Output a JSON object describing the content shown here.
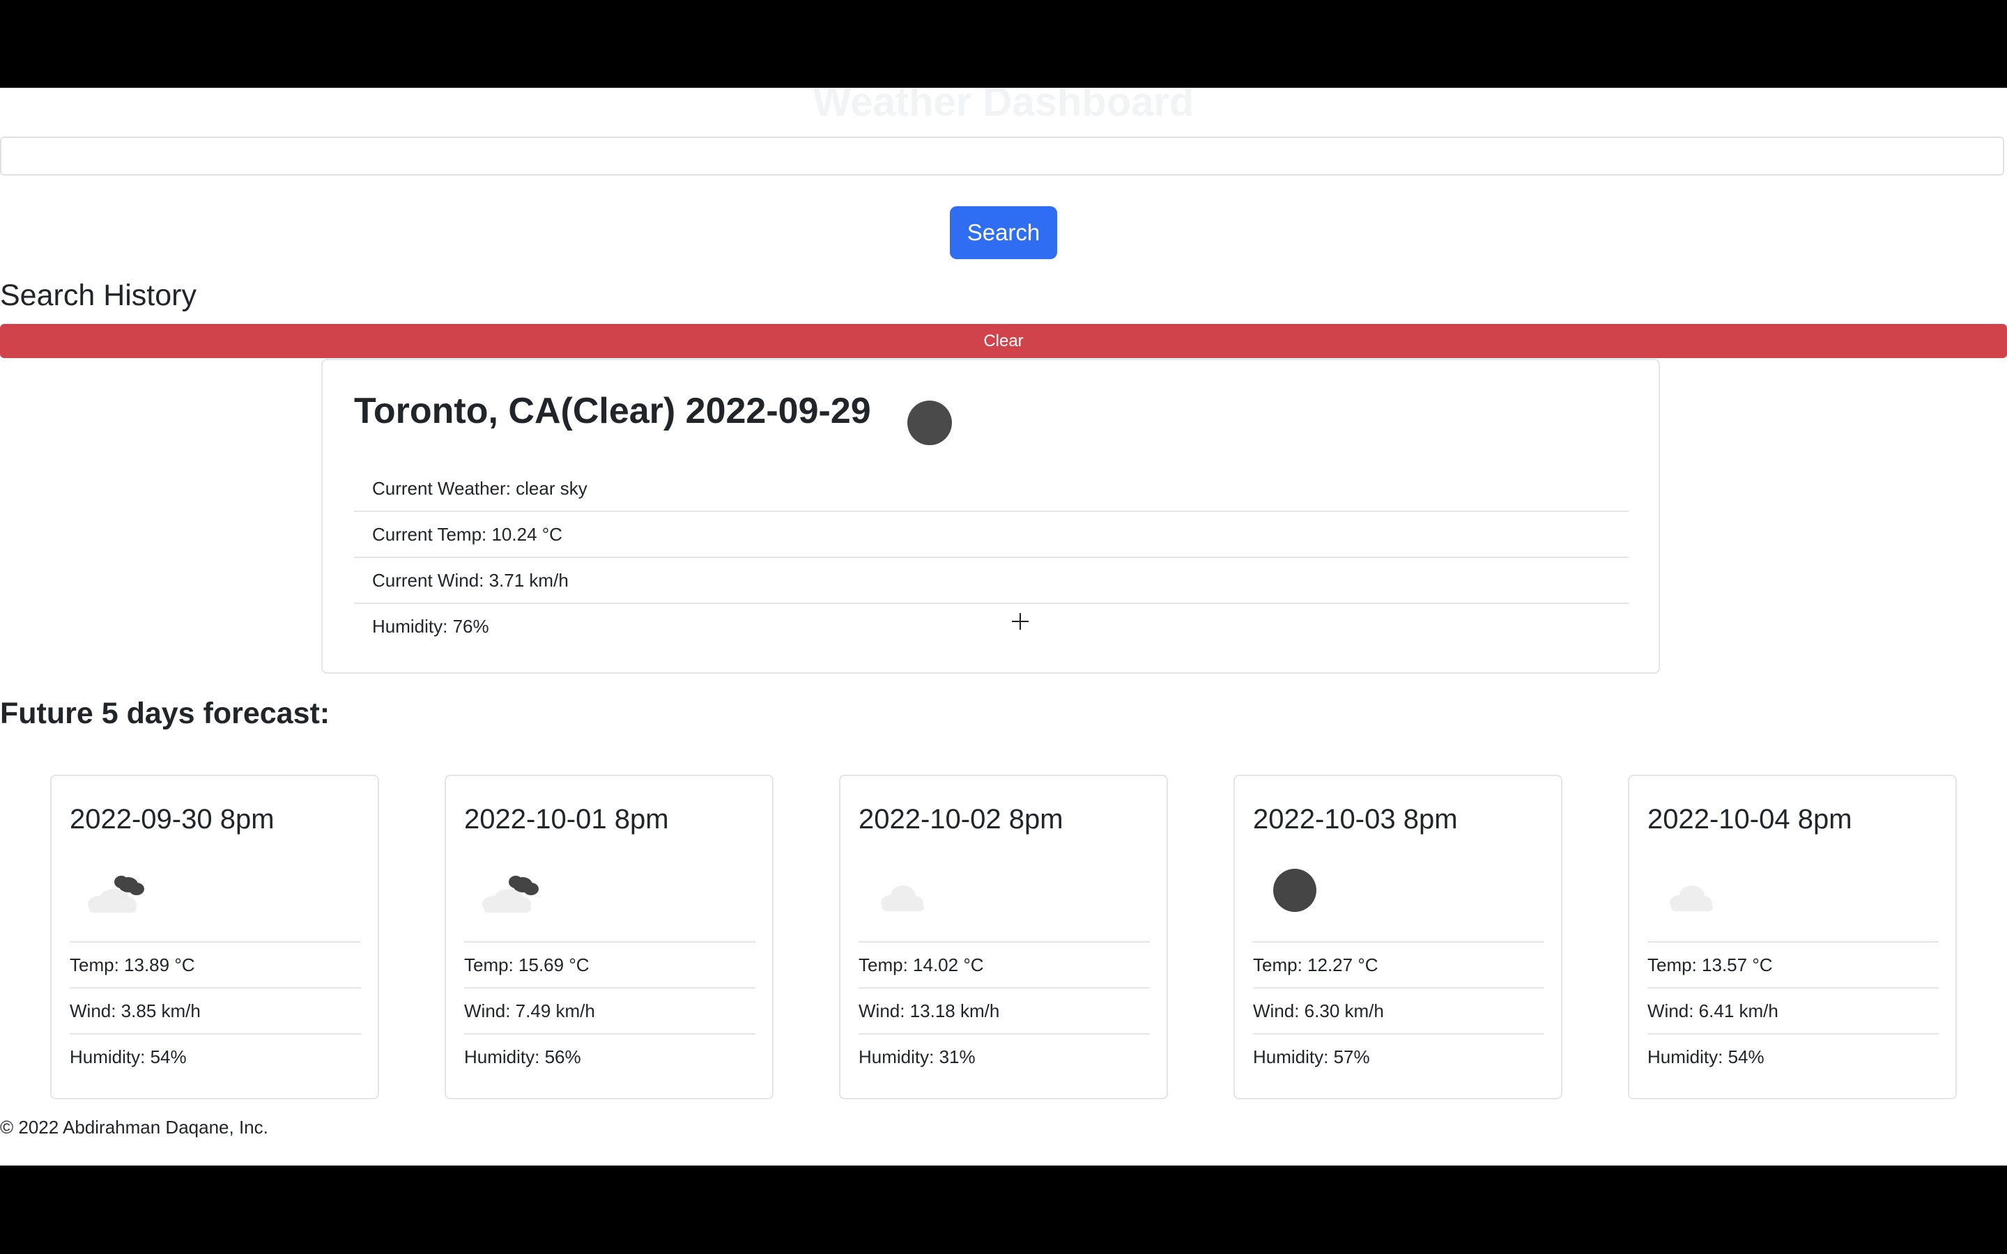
{
  "header": {
    "title": "Weather Dashboard"
  },
  "search": {
    "placeholder": "",
    "value": "",
    "button_label": "Search"
  },
  "history": {
    "heading": "Search History",
    "clear_label": "Clear"
  },
  "current": {
    "title": "Toronto, CA(Clear) 2022-09-29",
    "icon": "clear-sky-icon",
    "details": [
      "Current Weather: clear sky",
      "Current Temp: 10.24 °C",
      "Current Wind: 3.71 km/h",
      "Humidity: 76%"
    ]
  },
  "forecast": {
    "heading": "Future 5 days forecast:",
    "days": [
      {
        "date": "2022-09-30 8pm",
        "icon": "broken-clouds-icon",
        "temp": "Temp: 13.89 °C",
        "wind": "Wind: 3.85 km/h",
        "humidity": "Humidity: 54%"
      },
      {
        "date": "2022-10-01 8pm",
        "icon": "broken-clouds-icon",
        "temp": "Temp: 15.69 °C",
        "wind": "Wind: 7.49 km/h",
        "humidity": "Humidity: 56%"
      },
      {
        "date": "2022-10-02 8pm",
        "icon": "few-clouds-icon",
        "temp": "Temp: 14.02 °C",
        "wind": "Wind: 13.18 km/h",
        "humidity": "Humidity: 31%"
      },
      {
        "date": "2022-10-03 8pm",
        "icon": "clear-sky-icon",
        "temp": "Temp: 12.27 °C",
        "wind": "Wind: 6.30 km/h",
        "humidity": "Humidity: 57%"
      },
      {
        "date": "2022-10-04 8pm",
        "icon": "few-clouds-icon",
        "temp": "Temp: 13.57 °C",
        "wind": "Wind: 6.41 km/h",
        "humidity": "Humidity: 54%"
      }
    ]
  },
  "footer": {
    "text": "© 2022 Abdirahman Daqane, Inc."
  },
  "colors": {
    "primary": "#2f6ef2",
    "danger": "#d0434a",
    "border": "#e3e5e8"
  }
}
